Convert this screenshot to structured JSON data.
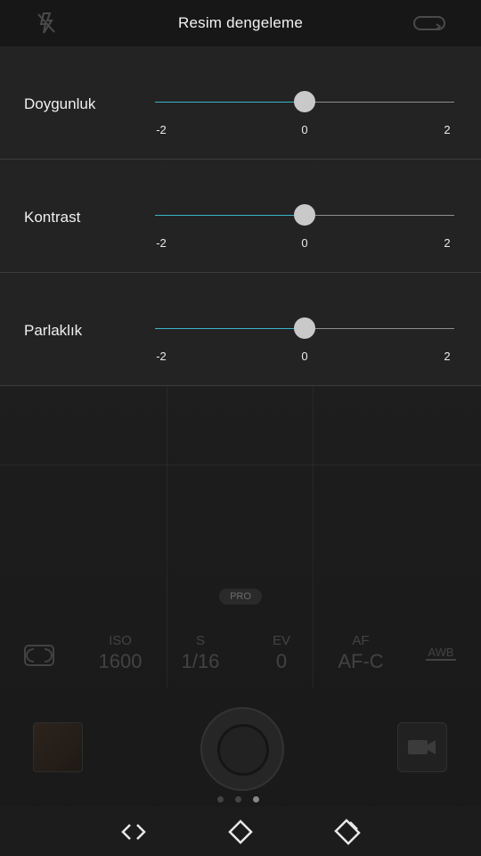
{
  "header": {
    "title": "Resim dengeleme",
    "left_icon": "flash-off-icon",
    "right_icon": "switch-camera-icon"
  },
  "adjustments": [
    {
      "label": "Doygunluk",
      "min_label": "-2",
      "mid_label": "0",
      "max_label": "2",
      "value": 0,
      "min": -2,
      "max": 2
    },
    {
      "label": "Kontrast",
      "min_label": "-2",
      "mid_label": "0",
      "max_label": "2",
      "value": 0,
      "min": -2,
      "max": 2
    },
    {
      "label": "Parlaklık",
      "min_label": "-2",
      "mid_label": "0",
      "max_label": "2",
      "value": 0,
      "min": -2,
      "max": 2
    }
  ],
  "pro_mode": {
    "tab_label": "PRO",
    "metering_icon": "metering-icon",
    "items": [
      {
        "key": "ISO",
        "value": "1600"
      },
      {
        "key": "S",
        "value": "1/16"
      },
      {
        "key": "EV",
        "value": "0"
      },
      {
        "key": "AF",
        "value": "AF-C"
      }
    ],
    "wb_label": "AWB"
  },
  "bottom": {
    "gallery_icon": "gallery-thumbnail-icon",
    "shutter_icon": "shutter-button-icon",
    "video_icon": "video-camera-icon",
    "page_dots": 3,
    "active_dot": 2
  },
  "navbar": {
    "icons": [
      "back-arrows-icon",
      "home-diamond-icon",
      "recent-apps-icon"
    ]
  },
  "colors": {
    "accent": "#3bb2c9",
    "thumb": "#c9c9c9",
    "track": "#8e8e8e"
  }
}
